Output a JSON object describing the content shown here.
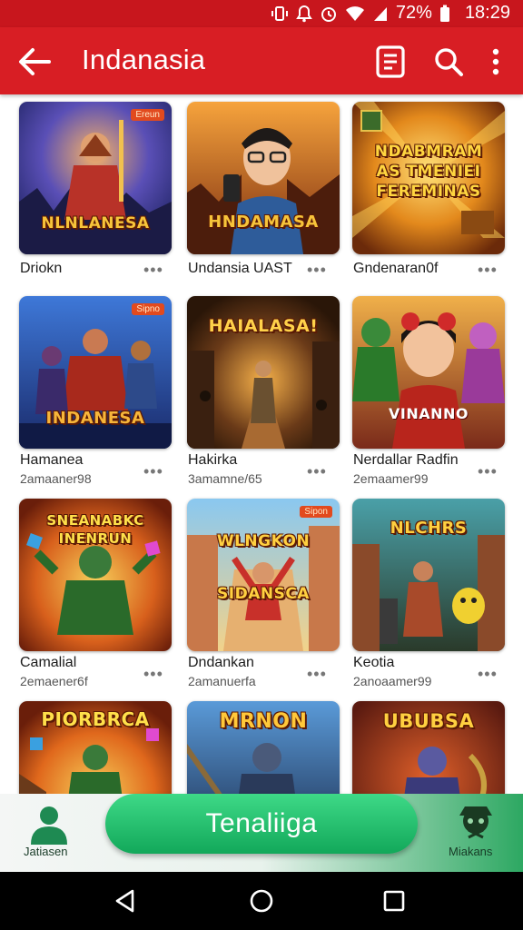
{
  "status": {
    "battery": "72%",
    "time": "18:29"
  },
  "appbar": {
    "title": "Indanasia",
    "icons": [
      "back-arrow-icon",
      "document-icon",
      "search-icon",
      "more-vert-icon"
    ]
  },
  "games": [
    {
      "name": "Driokn",
      "subtitle": "",
      "art": "NLNLANESA",
      "tag": "Ereun"
    },
    {
      "name": "Undansia UAST",
      "subtitle": "",
      "art": "HNDAMASA",
      "tag": ""
    },
    {
      "name": "Gndenaran0f",
      "subtitle": "",
      "art": "NDABMRAM\nAS TMENIEI\nFEREMINAS",
      "tag": ""
    },
    {
      "name": "Hamanea",
      "subtitle": "2amaaner98",
      "art": "INDANESA",
      "tag": "Sipno"
    },
    {
      "name": "Hakirka",
      "subtitle": "3amamne/65",
      "art": "HAIALASA!",
      "tag": ""
    },
    {
      "name": "Nerdallar Radfin",
      "subtitle": "2emaamer99",
      "art": "VINANNO",
      "tag": ""
    },
    {
      "name": "Camalial",
      "subtitle": "2emaener6f",
      "art": "SNEANABKC\nINENRUN",
      "tag": ""
    },
    {
      "name": "Dndankan",
      "subtitle": "2amanuerfa",
      "art": "WLNGKON\nSIDANSCA",
      "tag": "Sipon"
    },
    {
      "name": "Keotia",
      "subtitle": "2anoaamer99",
      "art": "NLCHRS",
      "tag": ""
    },
    {
      "name": "",
      "subtitle": "",
      "art": "PIORBRCA",
      "tag": ""
    },
    {
      "name": "",
      "subtitle": "",
      "art": "MRNON",
      "tag": ""
    },
    {
      "name": "",
      "subtitle": "",
      "art": "UBUBSA",
      "tag": ""
    }
  ],
  "more_label": "•••",
  "bottom": {
    "left_label": "Jatiasen",
    "cta": "Tenaliiga",
    "right_label": "Miakans"
  },
  "colors": {
    "appbar": "#d81e24",
    "statusbar": "#c8161d",
    "cta": "#1fb86b"
  }
}
